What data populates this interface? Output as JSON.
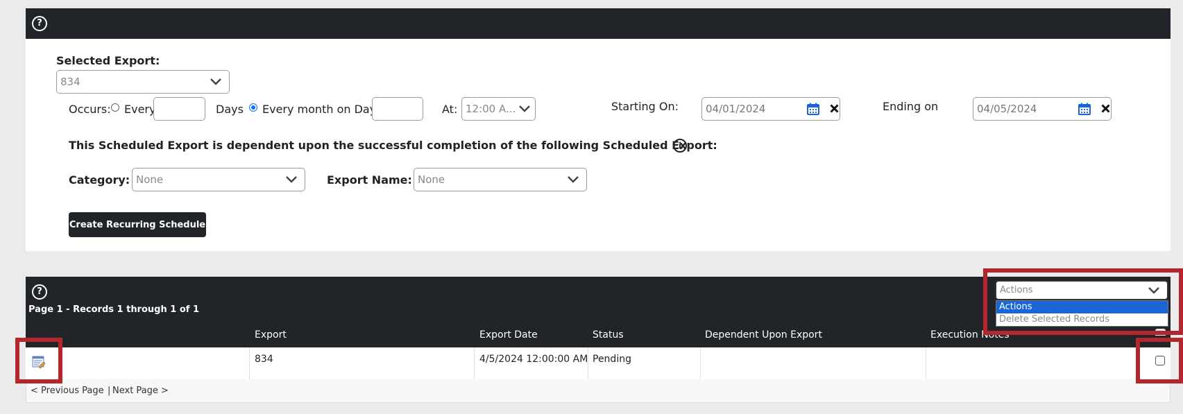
{
  "schedule": {
    "selected_export_label": "Selected Export:",
    "selected_export_value": "834",
    "occurs_label": "Occurs:",
    "every_label": "Every",
    "days_label": "Days",
    "monthly_label": "Every month on Day",
    "at_label": "At:",
    "at_value": "12:00 A...",
    "starting_label": "Starting On:",
    "starting_value": "04/01/2024",
    "ending_label": "Ending on",
    "ending_value": "04/05/2024",
    "dependency_text": "This Scheduled Export is dependent upon the successful completion of the following Scheduled Export:",
    "category_label": "Category:",
    "category_value": "None",
    "export_name_label": "Export Name:",
    "export_name_value": "None",
    "create_button": "Create Recurring Schedule"
  },
  "grid": {
    "paging_text": "Page 1 - Records 1 through 1 of 1",
    "actions_select": "Actions",
    "actions_options": [
      "Actions",
      "Delete Selected Records"
    ],
    "columns": [
      "Export",
      "Export Date",
      "Status",
      "Dependent Upon Export",
      "Execution Notes"
    ],
    "rows": [
      {
        "export": "834",
        "export_date": "4/5/2024 12:00:00 AM",
        "status": "Pending",
        "dependent": "",
        "notes": ""
      }
    ],
    "prev_page": "< Previous Page",
    "separator": "|",
    "next_page": "Next Page >"
  },
  "colors": {
    "header_bar": "#212529",
    "highlight_red": "#b3262d",
    "dropdown_selected": "#1a66d6"
  }
}
